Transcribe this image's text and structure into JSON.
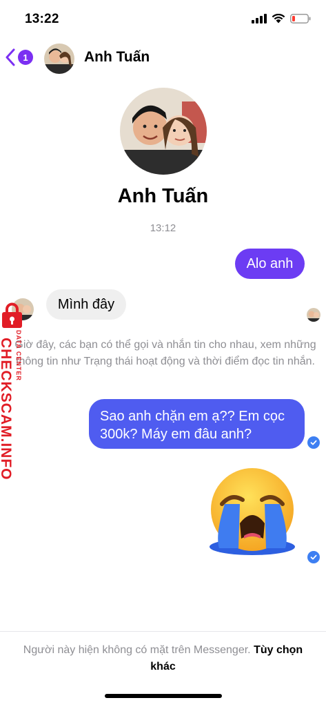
{
  "status_bar": {
    "time": "13:22",
    "icons": [
      "signal-icon",
      "wifi-icon",
      "battery-low-icon"
    ]
  },
  "header": {
    "unread_count": "1",
    "contact_name": "Anh Tuấn"
  },
  "profile": {
    "name": "Anh Tuấn",
    "timestamp": "13:12"
  },
  "messages": [
    {
      "id": "m1",
      "direction": "outgoing",
      "text": "Alo anh"
    },
    {
      "id": "m2",
      "direction": "incoming",
      "text": "Mình đây"
    },
    {
      "id": "m3",
      "direction": "outgoing",
      "text": "Sao anh chặn em ạ?? Em cọc 300k? Máy em đâu anh?"
    }
  ],
  "system_note": "Giờ đây, các bạn có thể gọi và nhắn tin cho nhau, xem những thông tin như Trạng thái hoạt động và thời điểm đọc tin nhắn.",
  "sticker": {
    "icon": "crying-face-sticker"
  },
  "footer": {
    "note": "Người này hiện không có mặt trên Messenger.",
    "link": "Tùy chọn khác"
  },
  "watermark": {
    "brand": "CHECKSCAM.INFO",
    "tagline": "DATA CENTER"
  },
  "colors": {
    "accent": "#7b2ff2",
    "outgoing_bubble": "#6c3cf3",
    "outgoing_bubble_2": "#4f5cf0",
    "seen_check": "#3d7ff2",
    "watermark": "#e11d26"
  }
}
